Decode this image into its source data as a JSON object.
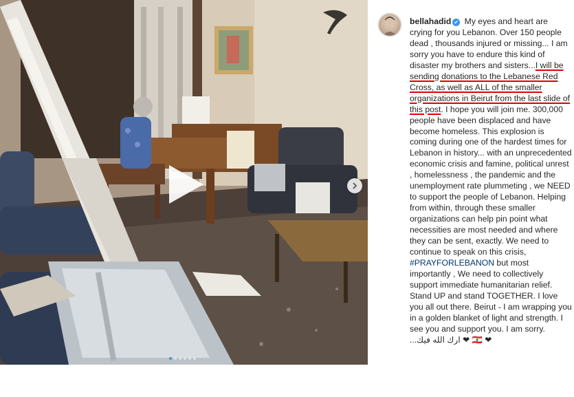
{
  "post": {
    "username": "bellahadid",
    "caption_part1": "My eyes and heart are crying for you Lebanon. Over 150 people dead , thousands injured or missing... I am sorry you have to endure this kind of disaster my brothers and sisters...",
    "caption_underlined": "I will be sending donations to the Lebanese Red Cross, as well as ALL of the smaller organizations in Beirut from the last slide of this post",
    "caption_part2": ". I hope you will join me. 300,000 people have been displaced and have become homeless. This explosion is coming during one of the hardest times for Lebanon in history... with an unprecedented economic crisis and famine, political unrest , homelessness , the pandemic and the unemployment rate plummeting , we NEED to support the people of Lebanon. Helping from within, through these smaller organizations can help pin point what necessities are most needed and where they can be sent, exactly. We need to continue to speak on this crisis, ",
    "hashtag": "#PRAYFORLEBANON",
    "caption_part3": " but most importantly , We need to collectively support immediate humanitarian relief. Stand UP and stand TOGETHER. I love you all out there. Beirut - I am wrapping you in a golden blanket of light and strength. I see you and support you. I am sorry.",
    "arabic_line": "...ارك الله فيك ❤ 🇱🇧 ❤"
  },
  "media": {
    "slide_count": 6,
    "active_slide": 0
  },
  "icons": {
    "play": "play-icon",
    "next": "chevron-right-icon",
    "verified": "verified-badge-icon"
  },
  "colors": {
    "accent": "#3897f0",
    "hashtag": "#00376b",
    "annotation": "#e00000",
    "text": "#262626"
  }
}
